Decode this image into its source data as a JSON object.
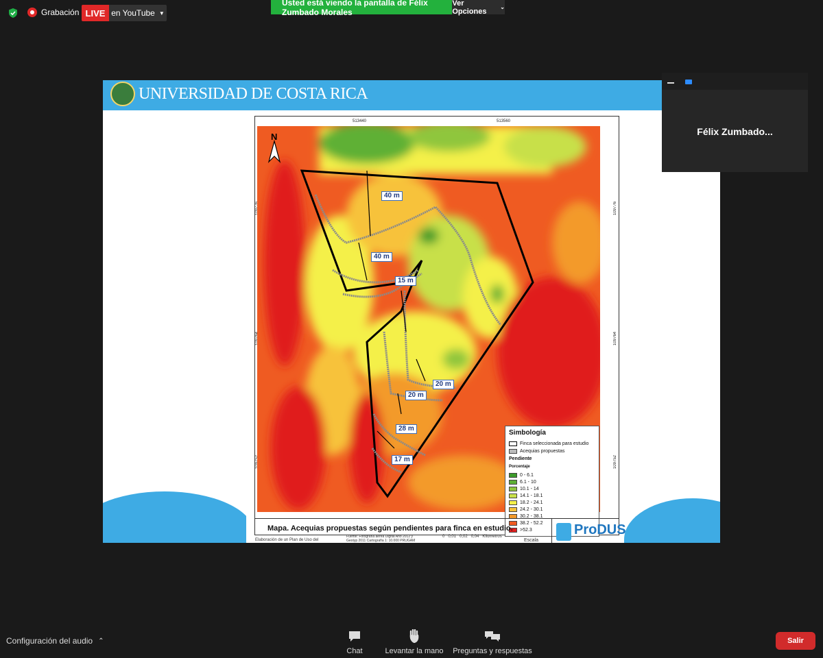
{
  "topbar": {
    "recording_label": "Grabación",
    "live_label": "LIVE",
    "youtube_label": "en YouTube",
    "banner_message": "Usted está viendo la pantalla de Félix Zumbado Morales",
    "view_options_label": "Ver Opciones"
  },
  "shared_screen": {
    "university_name": "UNIVERSIDAD DE COSTA RICA",
    "map": {
      "north_label": "N",
      "x_ticks": [
        "513440",
        "513560"
      ],
      "y_ticks": [
        "109776",
        "109764",
        "109752"
      ],
      "distance_labels": [
        "40 m",
        "40 m",
        "15 m",
        "20 m",
        "20 m",
        "28 m",
        "17 m"
      ],
      "title": "Mapa. Acequias propuestas según pendientes para finca en estudio.",
      "subtitle": "Elaboración de un Plan de Uso del",
      "source": "Fuente: Fotografía aérea Digital Año 2012 y Geotyp 2011 Cartografía 1: 10.000 PRUGAM",
      "scale_label": "Escala",
      "scale_numbers": [
        "0",
        "0,01",
        "0,02",
        "0,04"
      ],
      "scale_unit": "Kilometros",
      "logo": "ProDUS",
      "legend": {
        "title": "Simbología",
        "parcel_label": "Finca seleccionada para estudio",
        "ditch_label": "Acequias propuestas",
        "slope_heading": "Pendiente",
        "percent_heading": "Porcentaje",
        "classes": [
          {
            "label": "0 - 6.1",
            "color": "#3c9a2a"
          },
          {
            "label": "6.1 - 10",
            "color": "#5fb035"
          },
          {
            "label": "10.1 - 14",
            "color": "#8fc63e"
          },
          {
            "label": "14.1 - 18.1",
            "color": "#c8e04a"
          },
          {
            "label": "18.2 - 24.1",
            "color": "#f4f04a"
          },
          {
            "label": "24.2 - 30.1",
            "color": "#f7c23a"
          },
          {
            "label": "30.2 - 38.1",
            "color": "#f39a2b"
          },
          {
            "label": "38.2 - 52.2",
            "color": "#ef5b22"
          },
          {
            "label": ">52.3",
            "color": "#e01f1f"
          }
        ]
      }
    }
  },
  "self_view": {
    "participant_name": "Félix  Zumbado..."
  },
  "bottombar": {
    "audio_settings_label": "Configuración del audio",
    "chat_label": "Chat",
    "raise_hand_label": "Levantar la mano",
    "qa_label": "Preguntas y respuestas",
    "leave_label": "Salir"
  },
  "colors": {
    "live_red": "#e02828",
    "banner_green": "#23b13d",
    "ucr_blue": "#3eabe4",
    "leave_red": "#d12b2b"
  }
}
